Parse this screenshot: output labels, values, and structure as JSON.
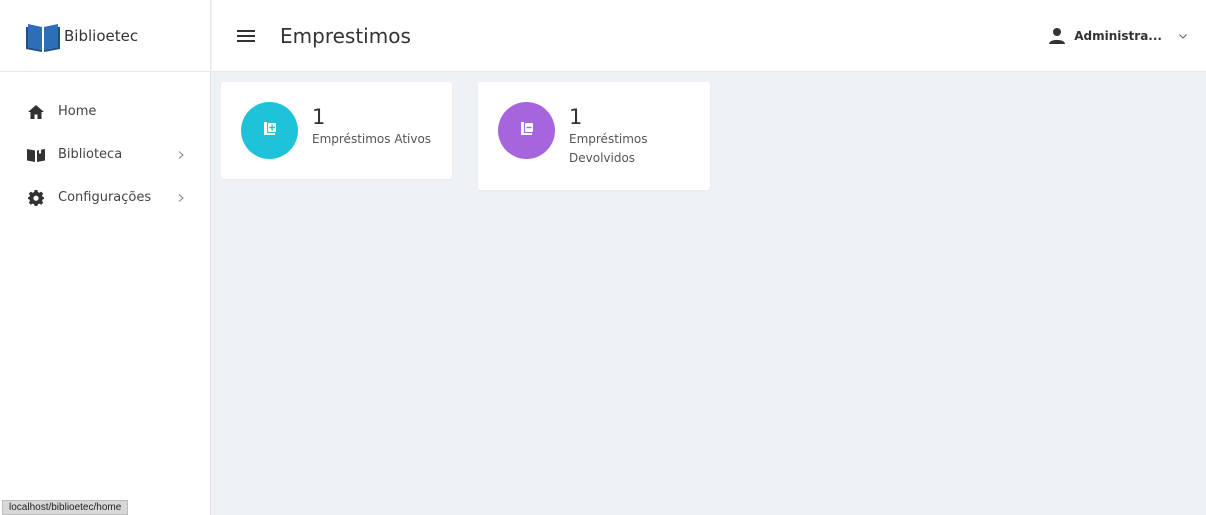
{
  "brand": {
    "name": "Biblioetec",
    "logo_color": "#2c6fb8"
  },
  "sidebar": {
    "items": [
      {
        "label": "Home",
        "icon": "home-icon",
        "has_submenu": false
      },
      {
        "label": "Biblioteca",
        "icon": "book-open-icon",
        "has_submenu": true
      },
      {
        "label": "Configurações",
        "icon": "gear-icon",
        "has_submenu": true
      }
    ]
  },
  "header": {
    "title": "Emprestimos",
    "user_name": "Administra..."
  },
  "cards": [
    {
      "count": "1",
      "label": "Empréstimos Ativos",
      "color": "#1ec3da",
      "icon": "books-plus-icon"
    },
    {
      "count": "1",
      "label": "Empréstimos Devolvidos",
      "color": "#a566dd",
      "icon": "books-return-icon"
    }
  ],
  "statusbar": {
    "url": "localhost/biblioetec/home"
  }
}
